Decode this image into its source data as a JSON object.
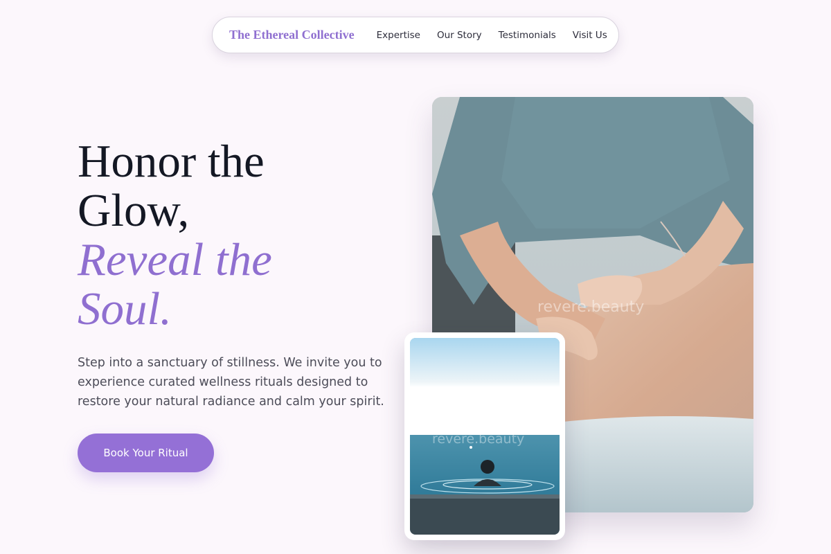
{
  "nav": {
    "brand": "The Ethereal Collective",
    "links": [
      "Expertise",
      "Our Story",
      "Testimonials",
      "Visit Us"
    ]
  },
  "hero": {
    "headline_line1": "Honor the",
    "headline_line2": "Glow,",
    "headline_accent_line1": "Reveal the",
    "headline_accent_line2": "Soul.",
    "intro": "Step into a sanctuary of stillness. We invite you to experience curated wellness rituals designed to restore your natural radiance and calm your spirit.",
    "cta_label": "Book Your Ritual"
  },
  "images": {
    "main_watermark": "revere.beauty",
    "inset_watermark": "revere.beauty"
  },
  "colors": {
    "background": "#fcf7fc",
    "accent": "#9470d6",
    "headline": "#141824",
    "body_text": "#4c4c58"
  }
}
